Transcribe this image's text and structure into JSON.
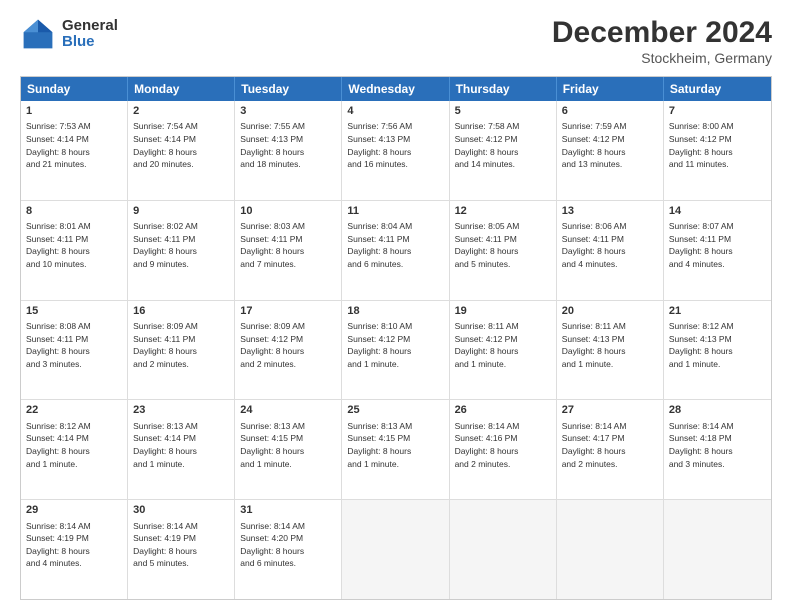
{
  "logo": {
    "general": "General",
    "blue": "Blue"
  },
  "title": "December 2024",
  "location": "Stockheim, Germany",
  "days": [
    "Sunday",
    "Monday",
    "Tuesday",
    "Wednesday",
    "Thursday",
    "Friday",
    "Saturday"
  ],
  "rows": [
    [
      {
        "day": "1",
        "text": "Sunrise: 7:53 AM\nSunset: 4:14 PM\nDaylight: 8 hours\nand 21 minutes."
      },
      {
        "day": "2",
        "text": "Sunrise: 7:54 AM\nSunset: 4:14 PM\nDaylight: 8 hours\nand 20 minutes."
      },
      {
        "day": "3",
        "text": "Sunrise: 7:55 AM\nSunset: 4:13 PM\nDaylight: 8 hours\nand 18 minutes."
      },
      {
        "day": "4",
        "text": "Sunrise: 7:56 AM\nSunset: 4:13 PM\nDaylight: 8 hours\nand 16 minutes."
      },
      {
        "day": "5",
        "text": "Sunrise: 7:58 AM\nSunset: 4:12 PM\nDaylight: 8 hours\nand 14 minutes."
      },
      {
        "day": "6",
        "text": "Sunrise: 7:59 AM\nSunset: 4:12 PM\nDaylight: 8 hours\nand 13 minutes."
      },
      {
        "day": "7",
        "text": "Sunrise: 8:00 AM\nSunset: 4:12 PM\nDaylight: 8 hours\nand 11 minutes."
      }
    ],
    [
      {
        "day": "8",
        "text": "Sunrise: 8:01 AM\nSunset: 4:11 PM\nDaylight: 8 hours\nand 10 minutes."
      },
      {
        "day": "9",
        "text": "Sunrise: 8:02 AM\nSunset: 4:11 PM\nDaylight: 8 hours\nand 9 minutes."
      },
      {
        "day": "10",
        "text": "Sunrise: 8:03 AM\nSunset: 4:11 PM\nDaylight: 8 hours\nand 7 minutes."
      },
      {
        "day": "11",
        "text": "Sunrise: 8:04 AM\nSunset: 4:11 PM\nDaylight: 8 hours\nand 6 minutes."
      },
      {
        "day": "12",
        "text": "Sunrise: 8:05 AM\nSunset: 4:11 PM\nDaylight: 8 hours\nand 5 minutes."
      },
      {
        "day": "13",
        "text": "Sunrise: 8:06 AM\nSunset: 4:11 PM\nDaylight: 8 hours\nand 4 minutes."
      },
      {
        "day": "14",
        "text": "Sunrise: 8:07 AM\nSunset: 4:11 PM\nDaylight: 8 hours\nand 4 minutes."
      }
    ],
    [
      {
        "day": "15",
        "text": "Sunrise: 8:08 AM\nSunset: 4:11 PM\nDaylight: 8 hours\nand 3 minutes."
      },
      {
        "day": "16",
        "text": "Sunrise: 8:09 AM\nSunset: 4:11 PM\nDaylight: 8 hours\nand 2 minutes."
      },
      {
        "day": "17",
        "text": "Sunrise: 8:09 AM\nSunset: 4:12 PM\nDaylight: 8 hours\nand 2 minutes."
      },
      {
        "day": "18",
        "text": "Sunrise: 8:10 AM\nSunset: 4:12 PM\nDaylight: 8 hours\nand 1 minute."
      },
      {
        "day": "19",
        "text": "Sunrise: 8:11 AM\nSunset: 4:12 PM\nDaylight: 8 hours\nand 1 minute."
      },
      {
        "day": "20",
        "text": "Sunrise: 8:11 AM\nSunset: 4:13 PM\nDaylight: 8 hours\nand 1 minute."
      },
      {
        "day": "21",
        "text": "Sunrise: 8:12 AM\nSunset: 4:13 PM\nDaylight: 8 hours\nand 1 minute."
      }
    ],
    [
      {
        "day": "22",
        "text": "Sunrise: 8:12 AM\nSunset: 4:14 PM\nDaylight: 8 hours\nand 1 minute."
      },
      {
        "day": "23",
        "text": "Sunrise: 8:13 AM\nSunset: 4:14 PM\nDaylight: 8 hours\nand 1 minute."
      },
      {
        "day": "24",
        "text": "Sunrise: 8:13 AM\nSunset: 4:15 PM\nDaylight: 8 hours\nand 1 minute."
      },
      {
        "day": "25",
        "text": "Sunrise: 8:13 AM\nSunset: 4:15 PM\nDaylight: 8 hours\nand 1 minute."
      },
      {
        "day": "26",
        "text": "Sunrise: 8:14 AM\nSunset: 4:16 PM\nDaylight: 8 hours\nand 2 minutes."
      },
      {
        "day": "27",
        "text": "Sunrise: 8:14 AM\nSunset: 4:17 PM\nDaylight: 8 hours\nand 2 minutes."
      },
      {
        "day": "28",
        "text": "Sunrise: 8:14 AM\nSunset: 4:18 PM\nDaylight: 8 hours\nand 3 minutes."
      }
    ],
    [
      {
        "day": "29",
        "text": "Sunrise: 8:14 AM\nSunset: 4:19 PM\nDaylight: 8 hours\nand 4 minutes."
      },
      {
        "day": "30",
        "text": "Sunrise: 8:14 AM\nSunset: 4:19 PM\nDaylight: 8 hours\nand 5 minutes."
      },
      {
        "day": "31",
        "text": "Sunrise: 8:14 AM\nSunset: 4:20 PM\nDaylight: 8 hours\nand 6 minutes."
      },
      null,
      null,
      null,
      null
    ]
  ]
}
